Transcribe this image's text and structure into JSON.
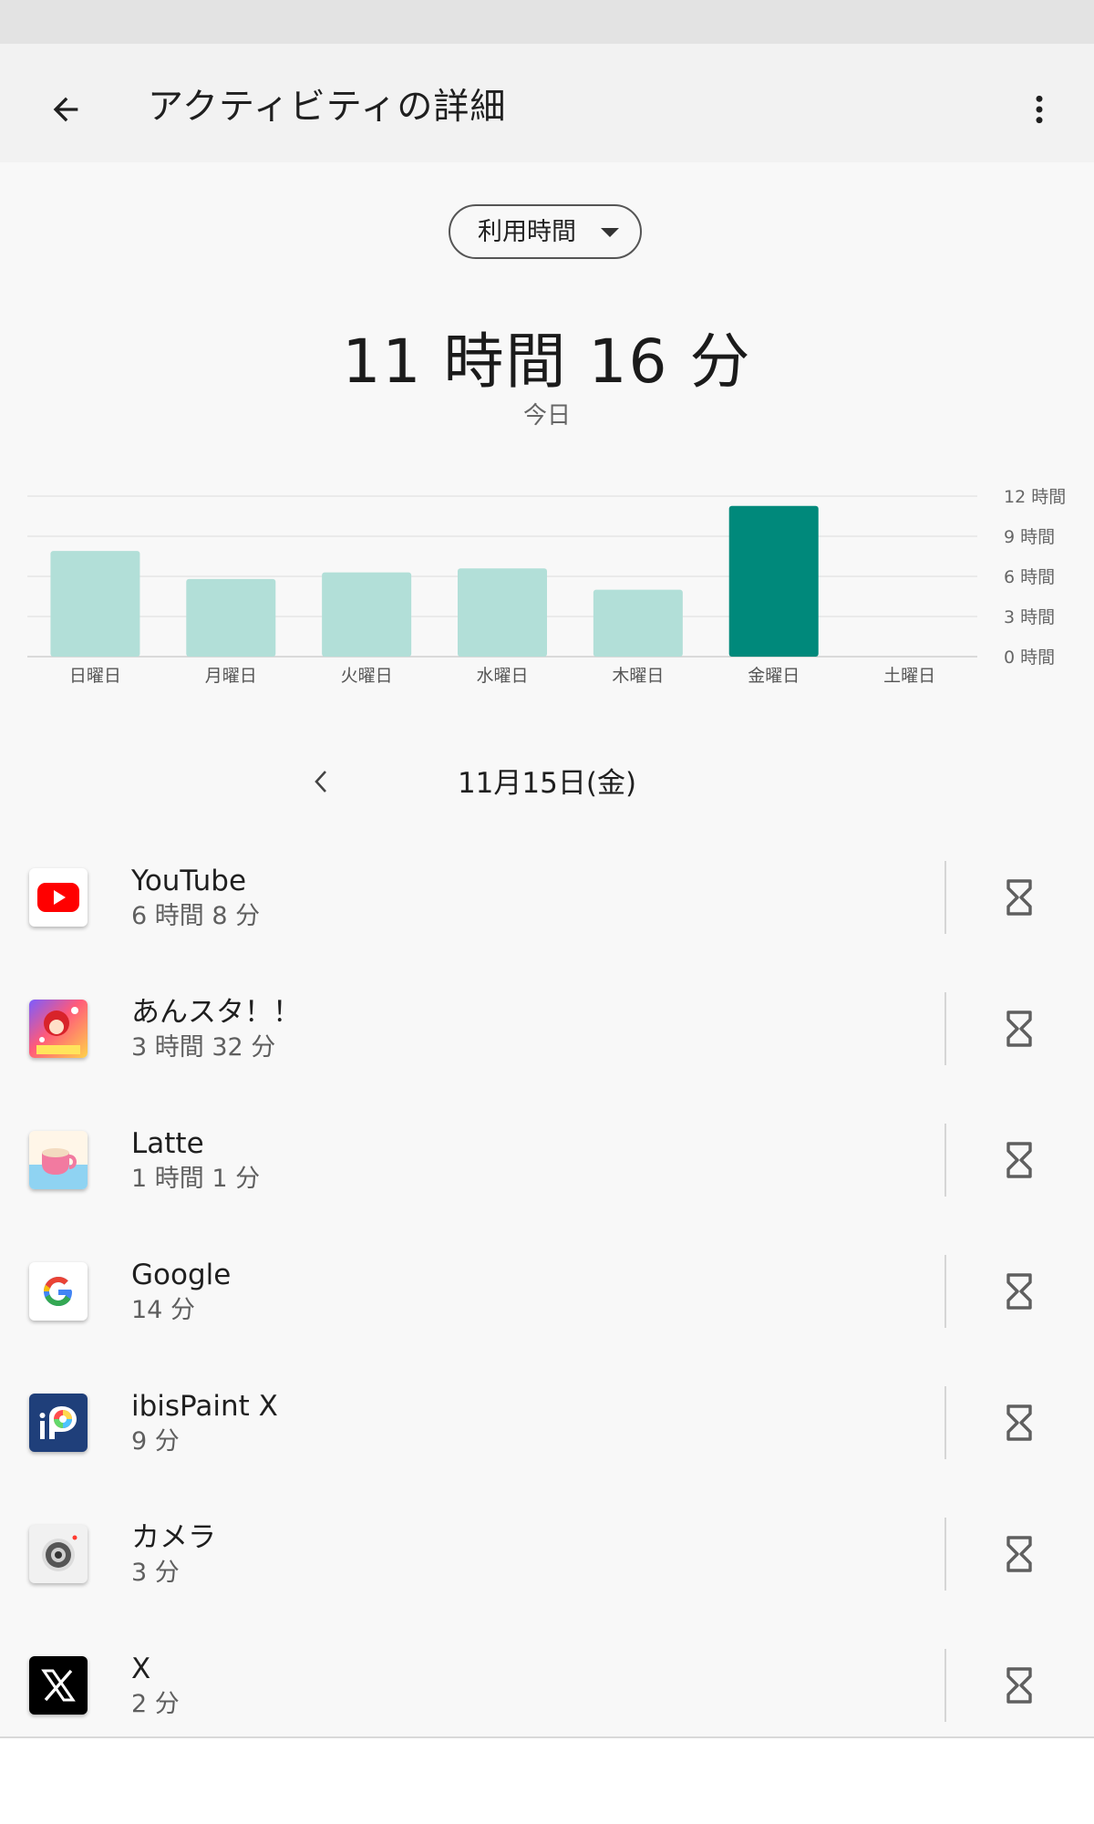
{
  "header": {
    "title": "アクティビティの詳細"
  },
  "metric_dropdown": {
    "selected": "利用時間"
  },
  "summary": {
    "total_time": "11 時間 16 分",
    "period_label": "今日"
  },
  "date_nav": {
    "current_date": "11月15日(金)"
  },
  "colors": {
    "selected_bar": "#00897b",
    "other_bar": "#b2dfd8",
    "youtube_red": "#ff0000"
  },
  "chart_data": {
    "type": "bar",
    "categories": [
      "日曜日",
      "月曜日",
      "火曜日",
      "水曜日",
      "木曜日",
      "金曜日",
      "土曜日"
    ],
    "values": [
      7.9,
      5.8,
      6.3,
      6.6,
      5.0,
      11.27,
      0
    ],
    "selected_index": 5,
    "y_ticks": [
      "0 時間",
      "3 時間",
      "6 時間",
      "9 時間",
      "12 時間"
    ],
    "ylim": [
      0,
      12
    ],
    "grid": true,
    "y_axis_side": "right"
  },
  "apps": [
    {
      "name": "YouTube",
      "time": "6 時間 8 分",
      "icon": "youtube-icon"
    },
    {
      "name": "あんスタ！！",
      "time": "3 時間 32 分",
      "icon": "ensemble-stars-icon"
    },
    {
      "name": "Latte",
      "time": "1 時間 1 分",
      "icon": "latte-cup-icon"
    },
    {
      "name": "Google",
      "time": "14 分",
      "icon": "google-g-icon"
    },
    {
      "name": "ibisPaint X",
      "time": "9 分",
      "icon": "ibispaint-icon"
    },
    {
      "name": "カメラ",
      "time": "3 分",
      "icon": "camera-icon"
    },
    {
      "name": "X",
      "time": "2 分",
      "icon": "x-logo-icon"
    }
  ]
}
